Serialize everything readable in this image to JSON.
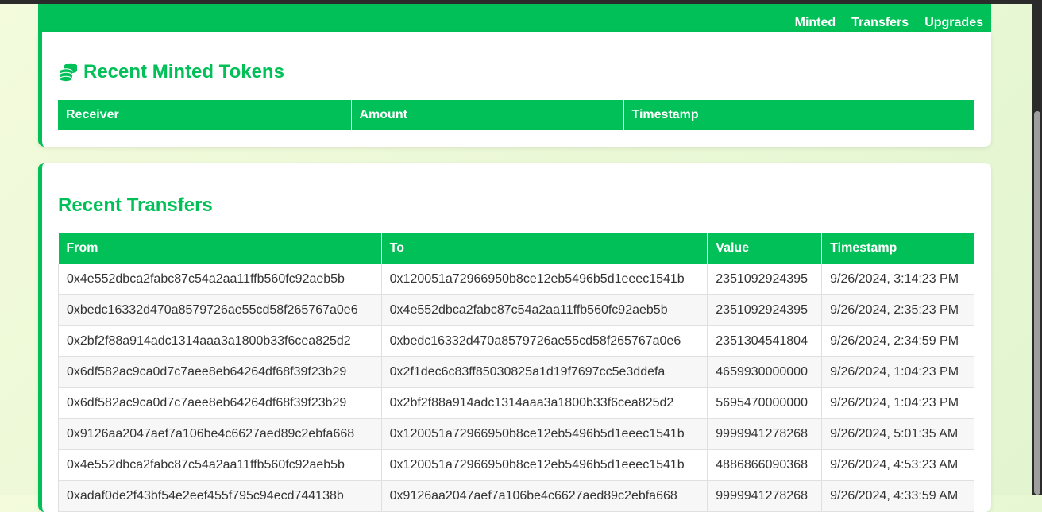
{
  "nav": {
    "links": [
      "Minted",
      "Transfers",
      "Upgrades"
    ]
  },
  "minted": {
    "title": "Recent Minted Tokens",
    "icon": "coins-icon",
    "columns": [
      "Receiver",
      "Amount",
      "Timestamp"
    ]
  },
  "transfers": {
    "title": "Recent Transfers",
    "columns": [
      "From",
      "To",
      "Value",
      "Timestamp"
    ],
    "rows": [
      [
        "0x4e552dbca2fabc87c54a2aa11ffb560fc92aeb5b",
        "0x120051a72966950b8ce12eb5496b5d1eeec1541b",
        "2351092924395",
        "9/26/2024, 3:14:23 PM"
      ],
      [
        "0xbedc16332d470a8579726ae55cd58f265767a0e6",
        "0x4e552dbca2fabc87c54a2aa11ffb560fc92aeb5b",
        "2351092924395",
        "9/26/2024, 2:35:23 PM"
      ],
      [
        "0x2bf2f88a914adc1314aaa3a1800b33f6cea825d2",
        "0xbedc16332d470a8579726ae55cd58f265767a0e6",
        "2351304541804",
        "9/26/2024, 2:34:59 PM"
      ],
      [
        "0x6df582ac9ca0d7c7aee8eb64264df68f39f23b29",
        "0x2f1dec6c83ff85030825a1d19f7697cc5e3ddefa",
        "4659930000000",
        "9/26/2024, 1:04:23 PM"
      ],
      [
        "0x6df582ac9ca0d7c7aee8eb64264df68f39f23b29",
        "0x2bf2f88a914adc1314aaa3a1800b33f6cea825d2",
        "5695470000000",
        "9/26/2024, 1:04:23 PM"
      ],
      [
        "0x9126aa2047aef7a106be4c6627aed89c2ebfa668",
        "0x120051a72966950b8ce12eb5496b5d1eeec1541b",
        "9999941278268",
        "9/26/2024, 5:01:35 AM"
      ],
      [
        "0x4e552dbca2fabc87c54a2aa11ffb560fc92aeb5b",
        "0x120051a72966950b8ce12eb5496b5d1eeec1541b",
        "4886866090368",
        "9/26/2024, 4:53:23 AM"
      ],
      [
        "0xadaf0de2f43bf54e2eef455f795c94ecd744138b",
        "0x9126aa2047aef7a106be4c6627aed89c2ebfa668",
        "9999941278268",
        "9/26/2024, 4:33:59 AM"
      ]
    ]
  },
  "colors": {
    "accent": "#00c057"
  }
}
